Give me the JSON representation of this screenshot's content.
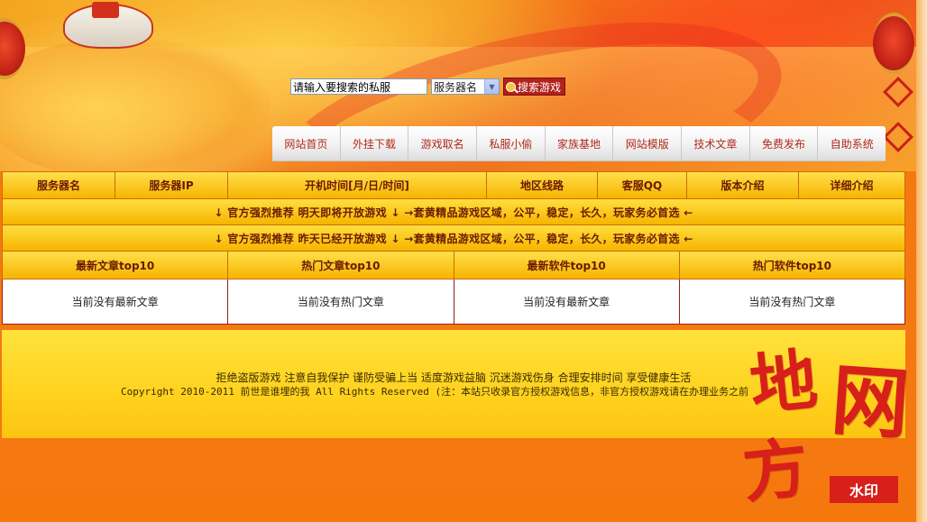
{
  "search": {
    "input_value": "请输入要搜索的私服",
    "select_value": "服务器名",
    "button_label": "搜索游戏"
  },
  "nav": {
    "items": [
      "网站首页",
      "外挂下载",
      "游戏取名",
      "私服小偷",
      "家族基地",
      "网站模版",
      "技术文章",
      "免费发布",
      "自助系统"
    ]
  },
  "server_table": {
    "headers": [
      "服务器名",
      "服务器IP",
      "开机时间[月/日/时间]",
      "地区线路",
      "客服QQ",
      "版本介绍",
      "详细介绍"
    ]
  },
  "promos": [
    "↓ 官方强烈推荐 明天即将开放游戏 ↓ →套黄精品游戏区域，公平，稳定，长久，玩家务必首选 ←",
    "↓ 官方强烈推荐 昨天已经开放游戏 ↓ →套黄精品游戏区域，公平，稳定，长久，玩家务必首选 ←"
  ],
  "top10": {
    "headers": [
      "最新文章top10",
      "热门文章top10",
      "最新软件top10",
      "热门软件top10"
    ],
    "cells": [
      "当前没有最新文章",
      "当前没有热门文章",
      "当前没有最新文章",
      "当前没有热门文章"
    ]
  },
  "footer": {
    "line1": "拒绝盗版游戏 注意自我保护 谨防受骗上当 适度游戏益脑 沉迷游戏伤身 合理安排时间 享受健康生活",
    "line2": "Copyright 2010-2011 前世是谁埋的我 All Rights Reserved (注：本站只收录官方授权游戏信息，非官方授权游戏请在办理业务之前"
  },
  "watermark": {
    "char1": "地",
    "char2": "网",
    "char3": "方",
    "stamp": "水印"
  },
  "colors": {
    "accent_red": "#b2211b",
    "nav_text": "#b0291a",
    "header_gold": "#f6b400",
    "page_orange": "#f5780f"
  }
}
